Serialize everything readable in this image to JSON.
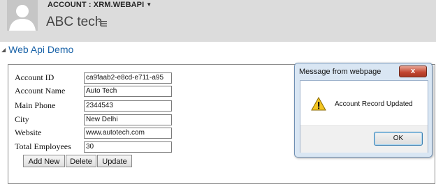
{
  "header": {
    "entity_type": "ACCOUNT : XRM.WEBAPI",
    "record_name": "ABC tech",
    "menu_icon": "hamburger-menu-icon",
    "background": "#dcdcdc"
  },
  "section": {
    "title": "Web Api Demo",
    "color": "#1a63a8"
  },
  "form": {
    "fields": [
      {
        "label": "Account ID",
        "value": "ca9faab2-e8cd-e711-a95"
      },
      {
        "label": "Account Name",
        "value": "Auto Tech"
      },
      {
        "label": "Main Phone",
        "value": "2344543"
      },
      {
        "label": "City",
        "value": "New Delhi"
      },
      {
        "label": "Website",
        "value": "www.autotech.com"
      },
      {
        "label": "Total Employees",
        "value": "30"
      }
    ],
    "buttons": {
      "add_new": "Add New",
      "delete": "Delete",
      "update": "Update"
    }
  },
  "dialog": {
    "title": "Message from webpage",
    "close_label": "x",
    "message": "Account Record Updated",
    "ok_label": "OK",
    "icon": "warning-icon"
  }
}
